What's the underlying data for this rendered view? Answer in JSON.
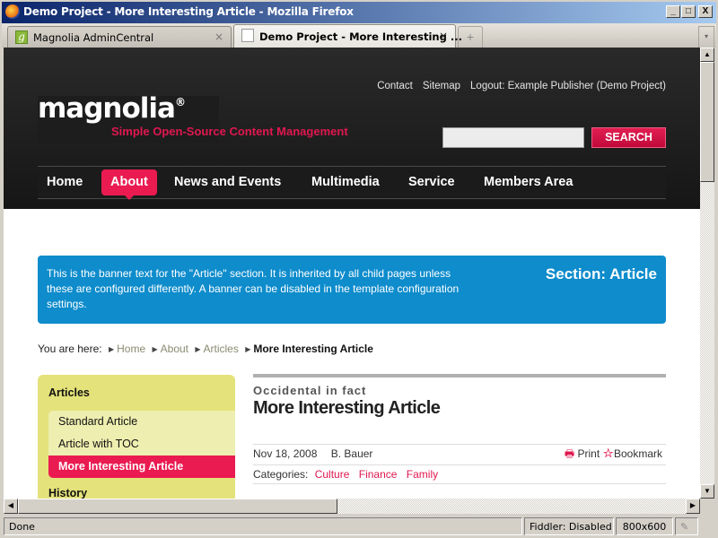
{
  "window": {
    "title": "Demo Project - More Interesting Article - Mozilla Firefox",
    "controls": {
      "minimize": "_",
      "maximize": "□",
      "close": "X"
    }
  },
  "tabs": [
    {
      "label": "Magnolia AdminCentral",
      "icon": "magnolia-g-icon",
      "close": "×",
      "active": false
    },
    {
      "label": "Demo Project - More Interesting ...",
      "icon": "page-icon",
      "close": "×",
      "active": true
    }
  ],
  "new_tab": "+",
  "tab_list": "▾",
  "site": {
    "top_links": [
      "Contact",
      "Sitemap",
      "Logout: Example Publisher (Demo Project)"
    ],
    "logo": {
      "word": "magnolia",
      "mark": "®",
      "tagline": "Simple Open-Source Content Management"
    },
    "search": {
      "value": "",
      "placeholder": "",
      "button": "SEARCH"
    },
    "nav": [
      {
        "label": "Home",
        "active": false
      },
      {
        "label": "About",
        "active": true
      },
      {
        "label": "News and Events",
        "active": false
      },
      {
        "label": "Multimedia",
        "active": false
      },
      {
        "label": "Service",
        "active": false
      },
      {
        "label": "Members Area",
        "active": false
      }
    ],
    "banner": {
      "text": "This is the banner text for the \"Article\" section. It is inherited by all child pages unless these are configured differently. A banner can be disabled in the template configuration settings.",
      "title": "Section: Article"
    },
    "breadcrumb": {
      "prefix": "You are here:",
      "links": [
        "Home",
        "About",
        "Articles"
      ],
      "current": "More Interesting Article"
    },
    "sidebar": {
      "heading": "Articles",
      "items": [
        {
          "label": "Standard Article",
          "active": false
        },
        {
          "label": "Article with TOC",
          "active": false
        },
        {
          "label": "More Interesting Article",
          "active": true
        }
      ],
      "next_heading": "History"
    },
    "article": {
      "kicker": "Occidental in fact",
      "title": "More Interesting Article",
      "date": "Nov 18, 2008",
      "author": "B. Bauer",
      "print": "Print",
      "bookmark": "Bookmark",
      "categories_label": "Categories:",
      "categories": [
        "Culture",
        "Finance",
        "Family"
      ]
    },
    "colors": {
      "accent": "#ea1b51",
      "banner": "#0e8ccc",
      "sidebar": "#e4e27a"
    }
  },
  "statusbar": {
    "status": "Done",
    "fiddler": "Fiddler: Disabled",
    "resolution": "800x600"
  }
}
